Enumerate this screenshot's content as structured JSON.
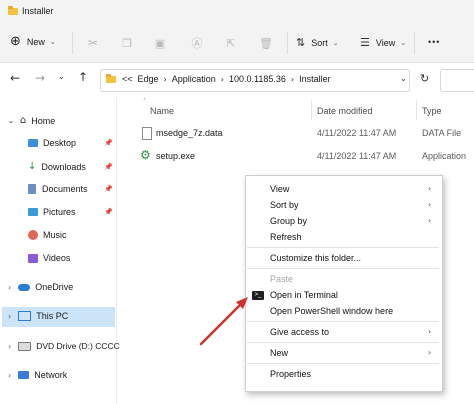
{
  "window": {
    "title": "Installer"
  },
  "toolbar": {
    "new_label": "New",
    "sort_label": "Sort",
    "view_label": "View",
    "more_label": "•••"
  },
  "address": {
    "overflow": "<<",
    "crumbs": [
      "Edge",
      "Application",
      "100.0.1185.36",
      "Installer"
    ]
  },
  "sidebar": {
    "home": "Home",
    "quick": [
      "Desktop",
      "Downloads",
      "Documents",
      "Pictures",
      "Music",
      "Videos"
    ],
    "onedrive": "OneDrive",
    "thispc": "This PC",
    "dvd": "DVD Drive (D:) CCCC",
    "network": "Network"
  },
  "columns": {
    "name": "Name",
    "date": "Date modified",
    "type": "Type"
  },
  "files": [
    {
      "name": "msedge_7z.data",
      "date": "4/11/2022 11:47 AM",
      "type": "DATA File"
    },
    {
      "name": "setup.exe",
      "date": "4/11/2022 11:47 AM",
      "type": "Application"
    }
  ],
  "context_menu": {
    "view": "View",
    "sortby": "Sort by",
    "groupby": "Group by",
    "refresh": "Refresh",
    "customize": "Customize this folder...",
    "paste": "Paste",
    "terminal": "Open in Terminal",
    "powershell": "Open PowerShell window here",
    "give_access": "Give access to",
    "new": "New",
    "properties": "Properties"
  },
  "colors": {
    "accent": "#0067c0",
    "annotation_arrow": "#d0312d",
    "folder": "#f3c242"
  }
}
